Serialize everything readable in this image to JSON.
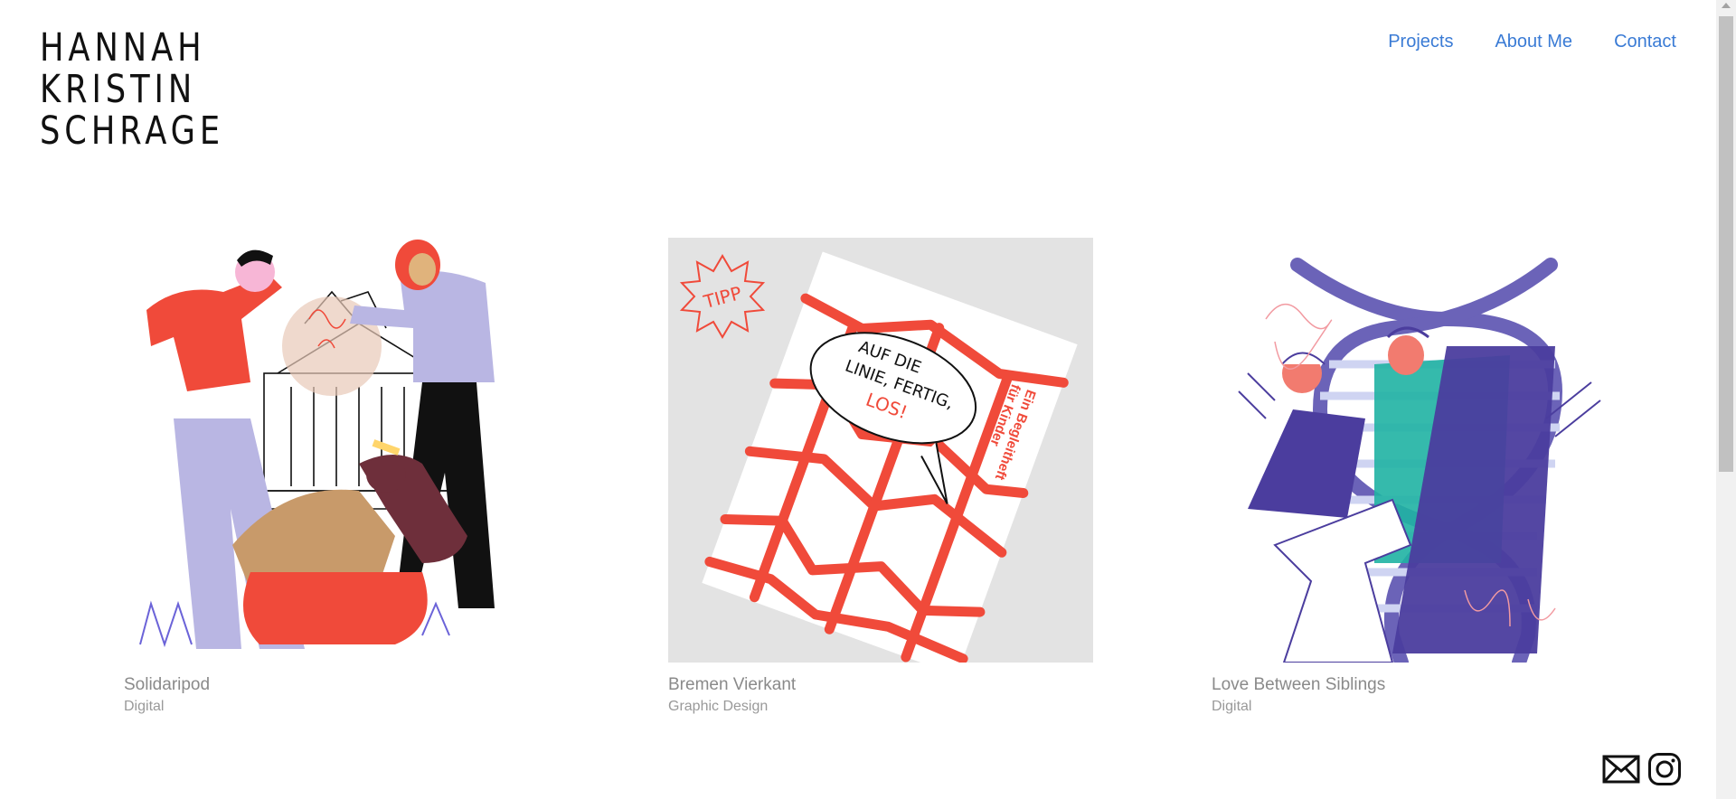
{
  "logo": {
    "lines": [
      "HANNAH",
      "KRISTIN",
      "SCHRAGE"
    ]
  },
  "nav": {
    "items": [
      "Projects",
      "About Me",
      "Contact"
    ]
  },
  "projects": [
    {
      "title": "Solidaripod",
      "category": "Digital"
    },
    {
      "title": "Bremen Vierkant",
      "category": "Graphic Design",
      "badge": "TIPP",
      "book_title": [
        "AUF DIE",
        "LINIE, FERTIG,",
        "LOS!"
      ],
      "book_subtitle": [
        "Ein Begleitheft",
        "für Kinder"
      ]
    },
    {
      "title": "Love Between Siblings",
      "category": "Digital"
    }
  ],
  "social": {
    "icons": [
      "mail-icon",
      "instagram-icon"
    ]
  },
  "colors": {
    "link": "#3a7bd5",
    "title": "#8a8a8a",
    "accent_red": "#f04a3a",
    "lavender": "#b9b6e3",
    "purple": "#4b3d9e",
    "teal": "#1fb3a3"
  }
}
